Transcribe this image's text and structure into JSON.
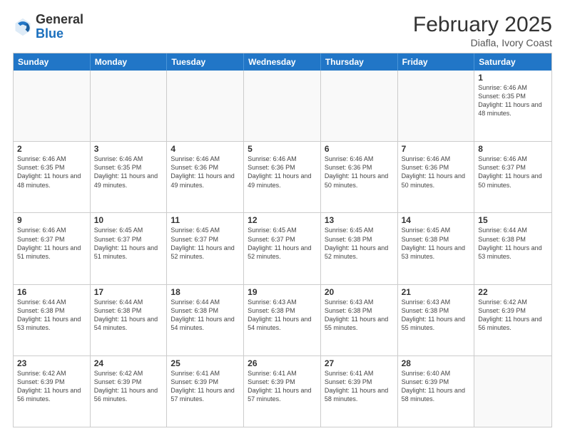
{
  "header": {
    "logo_general": "General",
    "logo_blue": "Blue",
    "month_title": "February 2025",
    "location": "Diafla, Ivory Coast"
  },
  "days_of_week": [
    "Sunday",
    "Monday",
    "Tuesday",
    "Wednesday",
    "Thursday",
    "Friday",
    "Saturday"
  ],
  "weeks": [
    [
      {
        "day": "",
        "text": ""
      },
      {
        "day": "",
        "text": ""
      },
      {
        "day": "",
        "text": ""
      },
      {
        "day": "",
        "text": ""
      },
      {
        "day": "",
        "text": ""
      },
      {
        "day": "",
        "text": ""
      },
      {
        "day": "1",
        "text": "Sunrise: 6:46 AM\nSunset: 6:35 PM\nDaylight: 11 hours and 48 minutes."
      }
    ],
    [
      {
        "day": "2",
        "text": "Sunrise: 6:46 AM\nSunset: 6:35 PM\nDaylight: 11 hours and 48 minutes."
      },
      {
        "day": "3",
        "text": "Sunrise: 6:46 AM\nSunset: 6:35 PM\nDaylight: 11 hours and 49 minutes."
      },
      {
        "day": "4",
        "text": "Sunrise: 6:46 AM\nSunset: 6:36 PM\nDaylight: 11 hours and 49 minutes."
      },
      {
        "day": "5",
        "text": "Sunrise: 6:46 AM\nSunset: 6:36 PM\nDaylight: 11 hours and 49 minutes."
      },
      {
        "day": "6",
        "text": "Sunrise: 6:46 AM\nSunset: 6:36 PM\nDaylight: 11 hours and 50 minutes."
      },
      {
        "day": "7",
        "text": "Sunrise: 6:46 AM\nSunset: 6:36 PM\nDaylight: 11 hours and 50 minutes."
      },
      {
        "day": "8",
        "text": "Sunrise: 6:46 AM\nSunset: 6:37 PM\nDaylight: 11 hours and 50 minutes."
      }
    ],
    [
      {
        "day": "9",
        "text": "Sunrise: 6:46 AM\nSunset: 6:37 PM\nDaylight: 11 hours and 51 minutes."
      },
      {
        "day": "10",
        "text": "Sunrise: 6:45 AM\nSunset: 6:37 PM\nDaylight: 11 hours and 51 minutes."
      },
      {
        "day": "11",
        "text": "Sunrise: 6:45 AM\nSunset: 6:37 PM\nDaylight: 11 hours and 52 minutes."
      },
      {
        "day": "12",
        "text": "Sunrise: 6:45 AM\nSunset: 6:37 PM\nDaylight: 11 hours and 52 minutes."
      },
      {
        "day": "13",
        "text": "Sunrise: 6:45 AM\nSunset: 6:38 PM\nDaylight: 11 hours and 52 minutes."
      },
      {
        "day": "14",
        "text": "Sunrise: 6:45 AM\nSunset: 6:38 PM\nDaylight: 11 hours and 53 minutes."
      },
      {
        "day": "15",
        "text": "Sunrise: 6:44 AM\nSunset: 6:38 PM\nDaylight: 11 hours and 53 minutes."
      }
    ],
    [
      {
        "day": "16",
        "text": "Sunrise: 6:44 AM\nSunset: 6:38 PM\nDaylight: 11 hours and 53 minutes."
      },
      {
        "day": "17",
        "text": "Sunrise: 6:44 AM\nSunset: 6:38 PM\nDaylight: 11 hours and 54 minutes."
      },
      {
        "day": "18",
        "text": "Sunrise: 6:44 AM\nSunset: 6:38 PM\nDaylight: 11 hours and 54 minutes."
      },
      {
        "day": "19",
        "text": "Sunrise: 6:43 AM\nSunset: 6:38 PM\nDaylight: 11 hours and 54 minutes."
      },
      {
        "day": "20",
        "text": "Sunrise: 6:43 AM\nSunset: 6:38 PM\nDaylight: 11 hours and 55 minutes."
      },
      {
        "day": "21",
        "text": "Sunrise: 6:43 AM\nSunset: 6:38 PM\nDaylight: 11 hours and 55 minutes."
      },
      {
        "day": "22",
        "text": "Sunrise: 6:42 AM\nSunset: 6:39 PM\nDaylight: 11 hours and 56 minutes."
      }
    ],
    [
      {
        "day": "23",
        "text": "Sunrise: 6:42 AM\nSunset: 6:39 PM\nDaylight: 11 hours and 56 minutes."
      },
      {
        "day": "24",
        "text": "Sunrise: 6:42 AM\nSunset: 6:39 PM\nDaylight: 11 hours and 56 minutes."
      },
      {
        "day": "25",
        "text": "Sunrise: 6:41 AM\nSunset: 6:39 PM\nDaylight: 11 hours and 57 minutes."
      },
      {
        "day": "26",
        "text": "Sunrise: 6:41 AM\nSunset: 6:39 PM\nDaylight: 11 hours and 57 minutes."
      },
      {
        "day": "27",
        "text": "Sunrise: 6:41 AM\nSunset: 6:39 PM\nDaylight: 11 hours and 58 minutes."
      },
      {
        "day": "28",
        "text": "Sunrise: 6:40 AM\nSunset: 6:39 PM\nDaylight: 11 hours and 58 minutes."
      },
      {
        "day": "",
        "text": ""
      }
    ]
  ]
}
